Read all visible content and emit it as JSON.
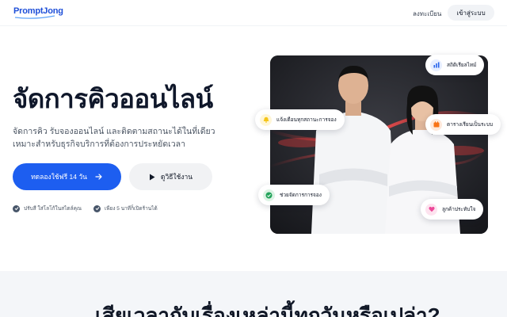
{
  "header": {
    "logo_text": "PromptJong",
    "register_label": "ลงทะเบียน",
    "login_label": "เข้าสู่ระบบ"
  },
  "hero": {
    "title": "จัดการคิวออนไลน์",
    "subtitle_line1": "จัดการคิว รับจองออนไลน์ และติดตามสถานะได้ในที่เดียว",
    "subtitle_line2": "เหมาะสำหรับธุรกิจบริการที่ต้องการประหยัดเวลา",
    "primary_button": "ทดลองใช้ฟรี 14 วัน",
    "secondary_button": "ดูวิธีใช้งาน",
    "check_1": "ปรับสี ใส่โลโก้ในสไตล์คุณ",
    "check_2": "เพียง 5 นาทีก็เปิดร้านได้"
  },
  "cards": {
    "stats": "สถิติเรียลไทม์",
    "notify": "แจ้งเตือนทุกสถานะการจอง",
    "schedule": "ตารางเรียนเป็นระบบ",
    "manage": "ช่วยจัดการการจอง",
    "customers": "ลูกค้าประทับใจ"
  },
  "colors": {
    "brand": "#1d5ef0",
    "stats_icon": "#2563eb",
    "notify_icon": "#f5c518",
    "schedule_icon": "#f97316",
    "manage_icon": "#22a35a",
    "customers_icon": "#ec4899"
  },
  "icons": {
    "stats": "bar-chart-icon",
    "notify": "bell-icon",
    "schedule": "calendar-icon",
    "manage": "check-circle-icon",
    "customers": "heart-icon"
  },
  "section2": {
    "title": "เสียเวลากับเรื่องเหล่านี้ทุกวันหรือเปล่า?"
  }
}
